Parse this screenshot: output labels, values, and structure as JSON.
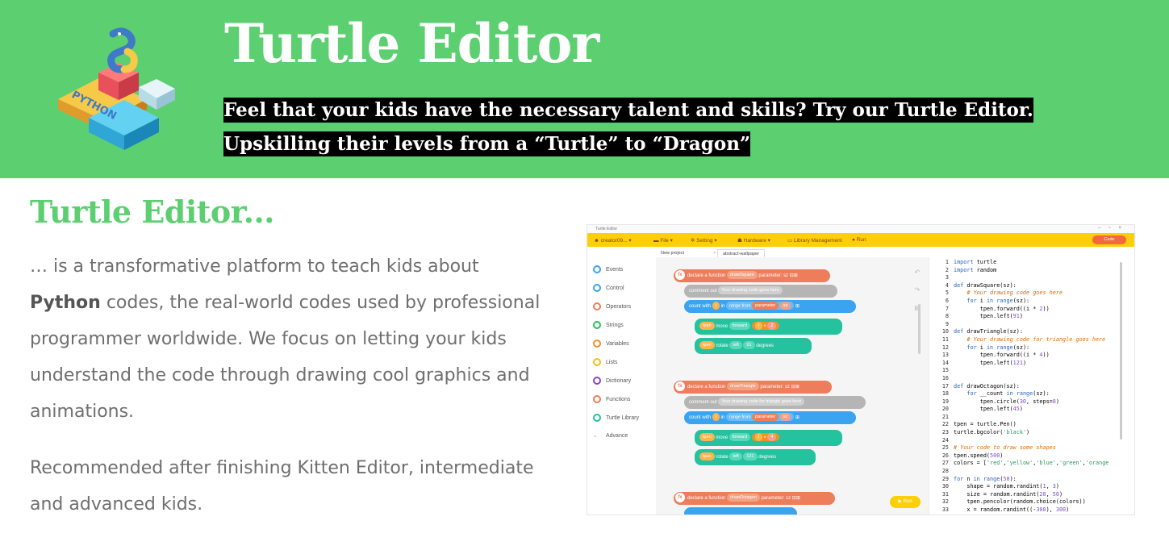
{
  "header": {
    "title": "Turtle Editor",
    "subtitle_line1": "Feel that your kids have the necessary talent and skills? Try our Turtle Editor.",
    "subtitle_line2": "Upskilling their levels from a “Turtle” to “Dragon”",
    "logo_text": "PYTHON"
  },
  "content": {
    "title": "Turtle Editor...",
    "paragraph1_before": "… is a transformative platform to teach kids about ",
    "paragraph1_bold": "Python",
    "paragraph1_after": " codes, the real-world codes used by professional programmer worldwide. We focus on letting your kids understand the code through drawing cool graphics and animations.",
    "paragraph2": "Recommended after finishing Kitten Editor, intermediate and advanced kids."
  },
  "screenshot": {
    "window_title": "Turtle Editor",
    "toolbar": {
      "user": "creator09...",
      "file": "File",
      "setting": "Setting",
      "hardware": "Hardware",
      "library": "Library Management",
      "run": "Run",
      "code": "Code"
    },
    "tabs": [
      "New project",
      "abstract-wallpaper"
    ],
    "categories": [
      {
        "label": "Events",
        "color": "#3aa4f1"
      },
      {
        "label": "Control",
        "color": "#3aa4f1"
      },
      {
        "label": "Operators",
        "color": "#ee7d5b"
      },
      {
        "label": "Strings",
        "color": "#25c25a"
      },
      {
        "label": "Variables",
        "color": "#f0902a"
      },
      {
        "label": "Lists",
        "color": "#fcbe09"
      },
      {
        "label": "Dictionary",
        "color": "#8e44c9"
      },
      {
        "label": "Functions",
        "color": "#ee7d5b"
      },
      {
        "label": "Turtle Library",
        "color": "#25c2a0"
      },
      {
        "label": "Advance",
        "color": "#f0902a"
      }
    ],
    "blocks": {
      "func1": {
        "a": "declare a function",
        "b": "drawSquare",
        "c": "parameter: sz"
      },
      "comment1": {
        "a": "comment out",
        "b": "Your drawing code goes here"
      },
      "count": {
        "a": "count with",
        "b": "i",
        "c": "in",
        "d": "range from",
        "e": "parameter",
        "f": "sz"
      },
      "move1": {
        "a": "tpen",
        "b": "move",
        "c": "forward",
        "d": "i",
        "e": "2"
      },
      "rotate1": {
        "a": "tpen",
        "b": "rotate",
        "c": "left",
        "d": "91",
        "e": "degrees"
      },
      "func2": {
        "a": "declare a function",
        "b": "drawTriangle",
        "c": "parameter: sz"
      },
      "comment2": {
        "a": "comment out",
        "b": "Your drawing code for triangle goes here"
      },
      "move2": {
        "a": "tpen",
        "b": "move",
        "c": "forward",
        "d": "i",
        "e": "4"
      },
      "rotate2": {
        "a": "tpen",
        "b": "rotate",
        "c": "left",
        "d": "121",
        "e": "degrees"
      },
      "func3": {
        "a": "declare a function",
        "b": "drawOctagon",
        "c": "parameter: sz"
      },
      "run": "Run"
    },
    "code_lines": [
      "import turtle",
      "import random",
      "",
      "def drawSquare(sz):",
      "    # Your drawing code goes here",
      "    for i in range(sz):",
      "        tpen.forward((i * 2))",
      "        tpen.left(91)",
      "",
      "def drawTriangle(sz):",
      "    # Your drawing code for triangle goes here",
      "    for i in range(sz):",
      "        tpen.forward((i * 4))",
      "        tpen.left(121)",
      "",
      "",
      "def drawOctagon(sz):",
      "    for __count in range(sz):",
      "        tpen.circle(30, steps=8)",
      "        tpen.left(45)",
      "",
      "tpen = turtle.Pen()",
      "turtle.bgcolor('black')",
      "",
      "# Your code to draw some shapes",
      "tpen.speed(500)",
      "colors = ['red','yellow','blue','green','orange",
      "",
      "for n in range(50):",
      "    shape = random.randint(1, 3)",
      "    size = random.randint(20, 50)",
      "    tpen.pencolor(random.choice(colors))",
      "    x = random.randint((-300), 300)"
    ]
  },
  "colors": {
    "brand_green": "#5ccf70",
    "toolbar_yellow": "#fccf09",
    "text_gray": "#6f6f6f"
  }
}
